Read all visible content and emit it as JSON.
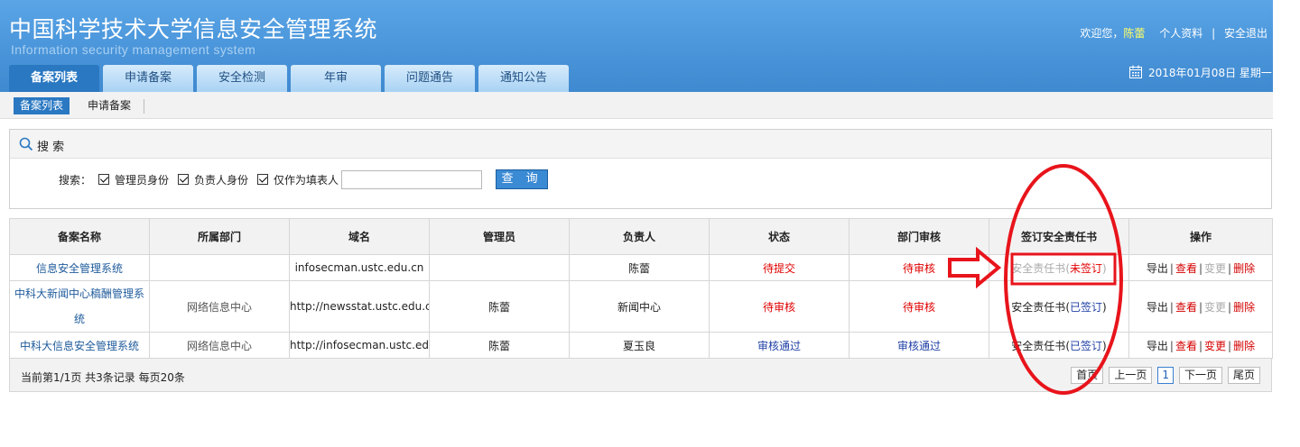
{
  "header": {
    "title": "中国科学技术大学信息安全管理系统",
    "subtitle": "Information security management system",
    "welcome": "欢迎您，",
    "user_name": "陈蕾",
    "profile_link": "个人资料",
    "divider": "|",
    "logout_link": "安全退出",
    "date": "2018年01月08日 星期一"
  },
  "nav": {
    "tabs": [
      "备案列表",
      "申请备案",
      "安全检测",
      "年审",
      "问题通告",
      "通知公告"
    ]
  },
  "subnav": {
    "items": [
      "备案列表",
      "申请备案"
    ]
  },
  "search": {
    "title": "搜 索",
    "label": "搜索：",
    "options": [
      "管理员身份",
      "负责人身份",
      "仅作为填表人"
    ],
    "input_value": "",
    "button": "查 询"
  },
  "table": {
    "headers": [
      "备案名称",
      "所属部门",
      "域名",
      "管理员",
      "负责人",
      "状态",
      "部门审核",
      "签订安全责任书",
      "操作"
    ],
    "rows": [
      {
        "name": "信息安全管理系统",
        "dept": "",
        "domain": "infosecman.ustc.edu.cn",
        "admin": "",
        "owner": "陈蕾",
        "status": "待提交",
        "review": "待审核",
        "sign_label": "安全责任书",
        "sign_open": "(",
        "sign_status": "未签订",
        "sign_close": ")",
        "ops": [
          "导出",
          "查看",
          "变更",
          "删除"
        ]
      },
      {
        "name": "中科大新闻中心稿酬管理系统",
        "dept": "网络信息中心",
        "domain": "http://newsstat.ustc.edu.cn",
        "admin": "陈蕾",
        "owner": "新闻中心",
        "status": "待审核",
        "review": "待审核",
        "sign_label": "安全责任书",
        "sign_open": "(",
        "sign_status": "已签订",
        "sign_close": ")",
        "ops": [
          "导出",
          "查看",
          "变更",
          "删除"
        ]
      },
      {
        "name": "中科大信息安全管理系统",
        "dept": "网络信息中心",
        "domain": "http://infosecman.ustc.edu",
        "admin": "陈蕾",
        "owner": "夏玉良",
        "status": "审核通过",
        "review": "审核通过",
        "sign_label": "安全责任书",
        "sign_open": "(",
        "sign_status": "已签订",
        "sign_close": ")",
        "ops": [
          "导出",
          "查看",
          "变更",
          "删除"
        ]
      }
    ],
    "op_separator": "|"
  },
  "pager": {
    "info": "当前第1/1页 共3条记录 每页20条",
    "first": "首页",
    "prev": "上一页",
    "current": "1",
    "next": "下一页",
    "last": "尾页"
  },
  "colors": {
    "header_blue": "#4a95da",
    "tab_active": "#2a78c2",
    "status_red": "#e00000",
    "status_blue": "#1f3fa5",
    "annotation_red": "#e8141b"
  }
}
